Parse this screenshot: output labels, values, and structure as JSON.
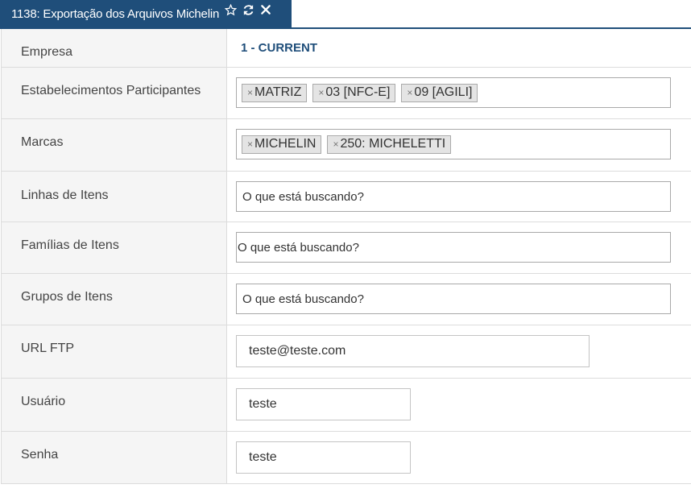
{
  "tab": {
    "title": "1138: Exportação dos Arquivos Michelin",
    "icons": [
      "star-outline-icon",
      "refresh-icon",
      "close-icon"
    ],
    "color": "#1f4e7a"
  },
  "form": {
    "empresa": {
      "label": "Empresa",
      "value": "1 - CURRENT"
    },
    "estabelecimentos": {
      "label": "Estabelecimentos Participantes",
      "tags": [
        "MATRIZ",
        "03 [NFC-E]",
        "09 [AGILI]"
      ]
    },
    "marcas": {
      "label": "Marcas",
      "tags": [
        "MICHELIN",
        "250: MICHELETTI"
      ]
    },
    "linhas": {
      "label": "Linhas de Itens",
      "placeholder": "O que está buscando?"
    },
    "familias": {
      "label": "Famílias de Itens",
      "placeholder": "O que está buscando?"
    },
    "grupos": {
      "label": "Grupos de Itens",
      "placeholder": "O que está buscando?"
    },
    "url_ftp": {
      "label": "URL FTP",
      "value": "teste@teste.com"
    },
    "usuario": {
      "label": "Usuário",
      "value": "teste"
    },
    "senha": {
      "label": "Senha",
      "value": "teste"
    }
  },
  "tag_remove_glyph": "×"
}
